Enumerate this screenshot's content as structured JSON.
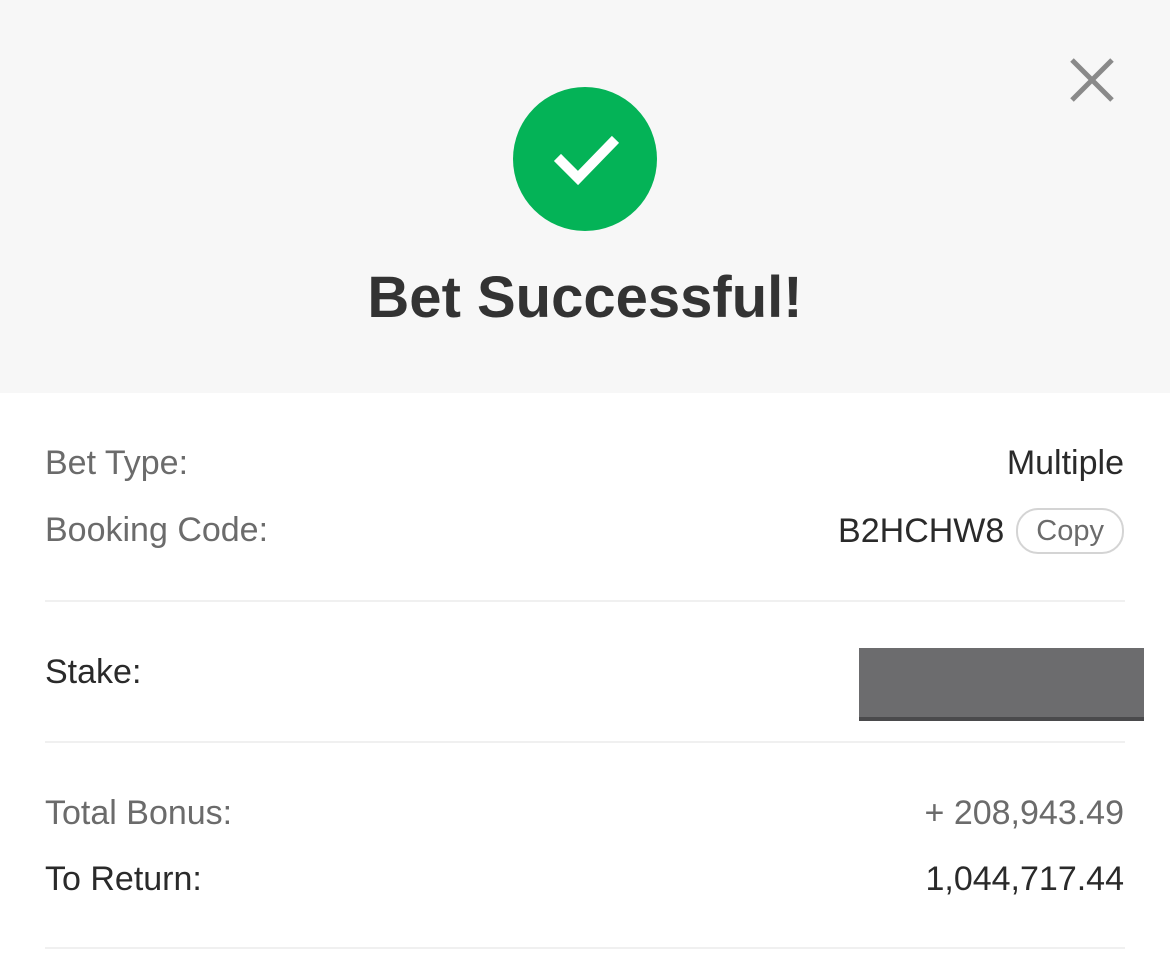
{
  "dialog": {
    "title": "Bet Successful!",
    "success_color": "#04b357",
    "success_icon": "checkmark-icon",
    "close_icon": "close-icon"
  },
  "details": {
    "bet_type_label": "Bet Type:",
    "bet_type_value": "Multiple",
    "booking_code_label": "Booking Code:",
    "booking_code_value": "B2HCHW8",
    "copy_label": "Copy",
    "stake_label": "Stake:",
    "total_bonus_label": "Total Bonus:",
    "total_bonus_value": "+ 208,943.49",
    "to_return_label": "To Return:",
    "to_return_value": "1,044,717.44"
  }
}
